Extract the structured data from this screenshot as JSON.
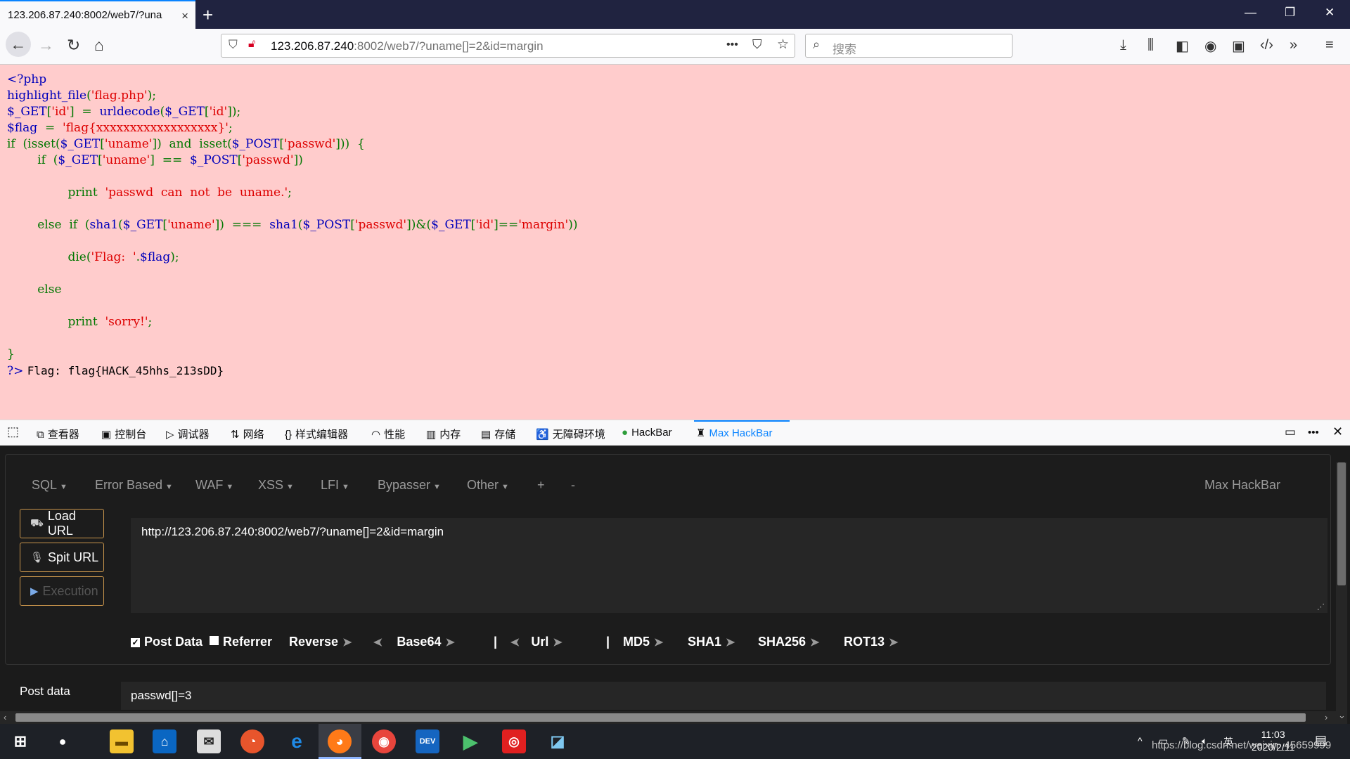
{
  "browser": {
    "tab_title": "123.206.87.240:8002/web7/?una",
    "tab_close": "×",
    "new_tab": "+",
    "url_host": "123.206.87.240",
    "url_rest": ":8002/web7/?uname[]=2&id=margin",
    "url_more": "•••",
    "search_placeholder": "搜索",
    "window_controls": [
      "—",
      "❐",
      "✕"
    ]
  },
  "code": {
    "line1": "<?php",
    "flag_output": "Flag: flag{HACK_45hhs_213sDD}"
  },
  "devtools": {
    "tabs": [
      {
        "icon": "⧉",
        "label": "查看器"
      },
      {
        "icon": "▣",
        "label": "控制台"
      },
      {
        "icon": "▷",
        "label": "调试器"
      },
      {
        "icon": "⇅",
        "label": "网络"
      },
      {
        "icon": "{}",
        "label": "样式编辑器"
      },
      {
        "icon": "◠",
        "label": "性能"
      },
      {
        "icon": "▥",
        "label": "内存"
      },
      {
        "icon": "▤",
        "label": "存储"
      },
      {
        "icon": "♿",
        "label": "无障碍环境"
      },
      {
        "icon": "●",
        "label": "HackBar"
      },
      {
        "icon": "♜",
        "label": "Max HackBar"
      }
    ]
  },
  "hackbar": {
    "menu": [
      "SQL",
      "Error Based",
      "WAF",
      "XSS",
      "LFI",
      "Bypasser",
      "Other",
      "+",
      "-"
    ],
    "brand": "Max HackBar",
    "buttons": {
      "load": "Load URL",
      "split": "Spit URL",
      "exec": "Execution"
    },
    "url_value": "http://123.206.87.240:8002/web7/?uname[]=2&id=margin",
    "options": {
      "post_data": "Post Data",
      "referrer": "Referrer",
      "reverse": "Reverse",
      "base64": "Base64",
      "sep": "|",
      "url": "Url",
      "md5": "MD5",
      "sha1": "SHA1",
      "sha256": "SHA256",
      "rot13": "ROT13"
    },
    "post_label": "Post data",
    "post_value": "passwd[]=3"
  },
  "taskbar": {
    "ime": "英",
    "time": "11:03",
    "date": "2020/2/11",
    "watermark": "https://blog.csdn.net/weixin_45659999"
  },
  "colors": {
    "accent": "#0a84ff",
    "page_bg": "#ffcccc",
    "button_border": "#c9954c"
  }
}
